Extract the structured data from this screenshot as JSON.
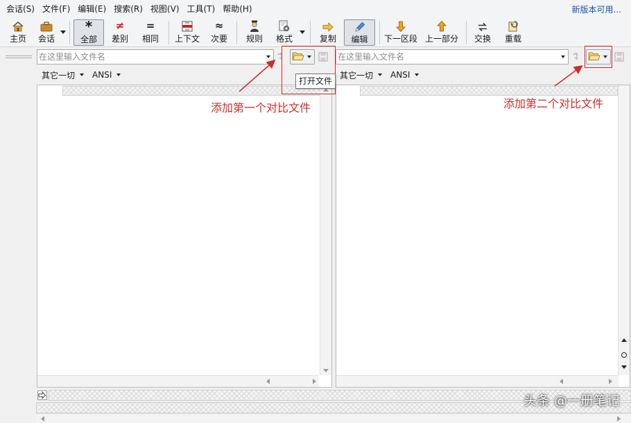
{
  "menu": {
    "items": [
      "会话(S)",
      "文件(F)",
      "编辑(E)",
      "搜索(R)",
      "视图(V)",
      "工具(T)",
      "帮助(H)"
    ],
    "update_notice": "新版本可用..."
  },
  "toolbar": {
    "home": "主页",
    "session": "会话",
    "all": "全部",
    "diffs": "差别",
    "same": "相同",
    "context": "上下文",
    "minor": "次要",
    "rules": "规则",
    "format": "格式",
    "copy": "复制",
    "edit": "编辑",
    "next_section": "下一区段",
    "prev_part": "上一部分",
    "swap": "交换",
    "reload": "重载",
    "glyph_all": "*",
    "glyph_diffs": "≠",
    "glyph_same": "=",
    "glyph_minor": "≈"
  },
  "left": {
    "placeholder": "在这里输入文件名",
    "filter": "其它一切",
    "encoding": "ANSI"
  },
  "right": {
    "placeholder": "在这里输入文件名",
    "filter": "其它一切",
    "encoding": "ANSI"
  },
  "tooltip": "打开文件",
  "annotations": {
    "left": "添加第一个对比文件",
    "right": "添加第二个对比文件",
    "color": "#d42a2a"
  },
  "watermark": "头条 @一册笔记",
  "colors": {
    "menu_bg": "#f3f4f6",
    "link": "#1f4fa8",
    "pane_bg": "#ffffff"
  },
  "icons": {
    "home": "home-icon",
    "session": "briefcase-icon",
    "context": "context-icon",
    "rules": "person-icon",
    "format": "gear-document-icon",
    "copy": "arrow-right-icon",
    "edit": "pencil-icon",
    "next_section": "arrow-down-icon",
    "prev_part": "arrow-up-icon",
    "swap": "swap-icon",
    "reload": "reload-icon",
    "open": "folder-icon",
    "save": "save-icon"
  }
}
